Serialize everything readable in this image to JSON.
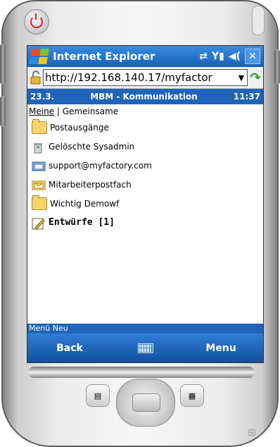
{
  "titlebar": {
    "title": "Internet Explorer",
    "icons": [
      "sync-icon",
      "signal-icon",
      "speaker-icon"
    ],
    "close": "✕"
  },
  "address": {
    "url": "http://192.168.140.17/myfactor",
    "go": "↷"
  },
  "pagehead": {
    "date": "23.3.",
    "title": "MBM - Kommunikation",
    "time": "11:37"
  },
  "subnav": {
    "meine": "Meine",
    "separator": " | ",
    "gemeinsame": "Gemeinsame"
  },
  "folders": [
    {
      "label": "Postausgänge",
      "icon": "folder-icon"
    },
    {
      "label": "Gelöschte Sysadmin",
      "icon": "recycle-bin-icon"
    },
    {
      "label": "support@myfactory.com",
      "icon": "mailbox-icon"
    },
    {
      "label": "Mitarbeiterpostfach",
      "icon": "mail-folder-icon"
    },
    {
      "label": "Wichtig Demowf",
      "icon": "folder-icon"
    },
    {
      "label": "Entwürfe [1]",
      "icon": "drafts-icon"
    }
  ],
  "statusbar": "Menü Neu",
  "softkeys": {
    "left": "Back",
    "right": "Menu"
  },
  "colors": {
    "titlebar": "#1f64b8",
    "folder": "#f7d56a"
  }
}
